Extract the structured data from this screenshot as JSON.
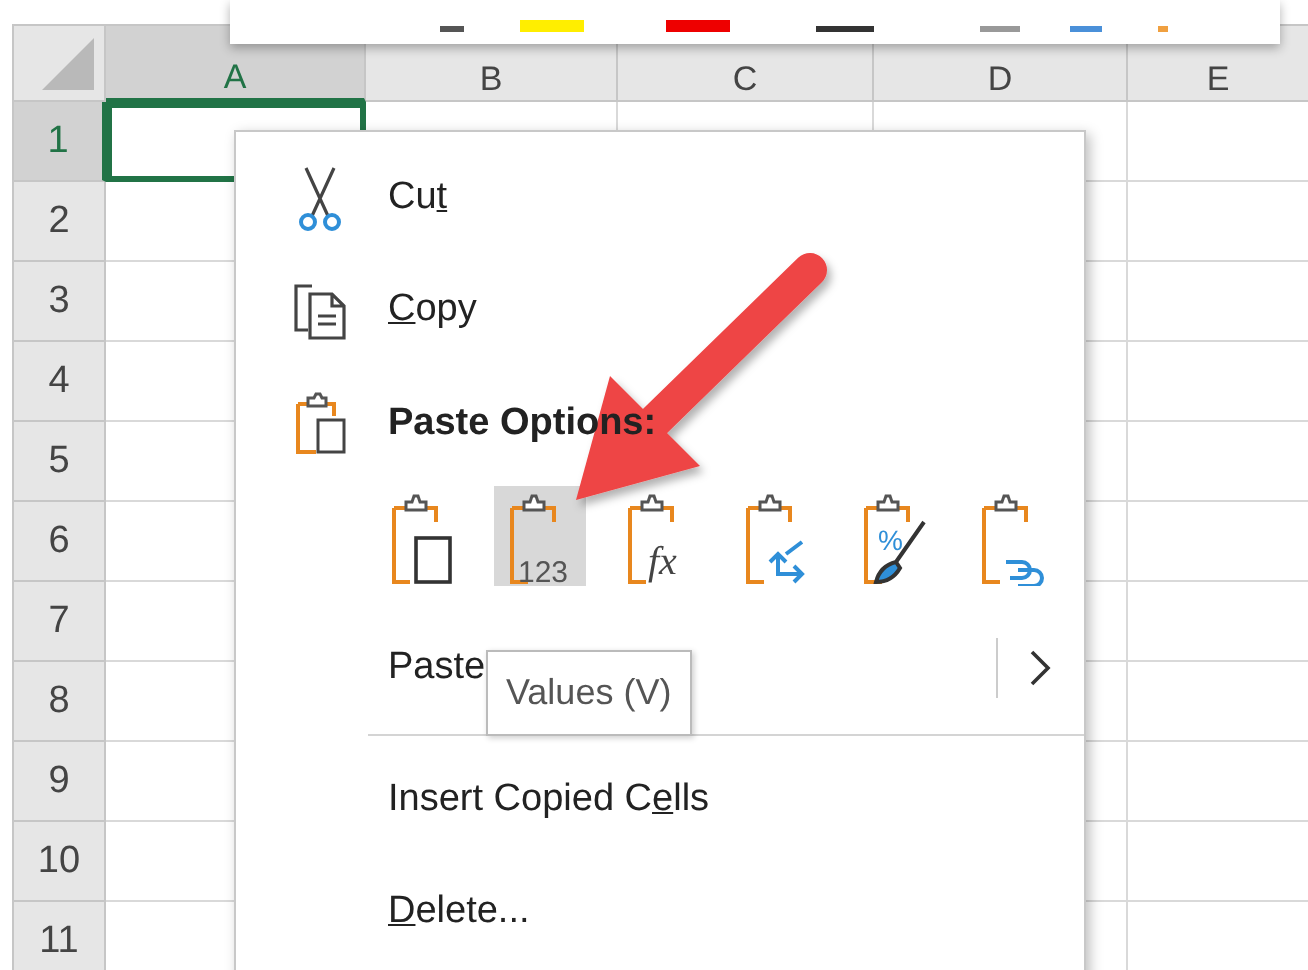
{
  "sheet": {
    "columns": [
      {
        "label": "A",
        "selected": true
      },
      {
        "label": "B",
        "selected": false
      },
      {
        "label": "C",
        "selected": false
      },
      {
        "label": "D",
        "selected": false
      },
      {
        "label": "E",
        "selected": false
      }
    ],
    "rows": [
      {
        "label": "1",
        "selected": true
      },
      {
        "label": "2",
        "selected": false
      },
      {
        "label": "3",
        "selected": false
      },
      {
        "label": "4",
        "selected": false
      },
      {
        "label": "5",
        "selected": false
      },
      {
        "label": "6",
        "selected": false
      },
      {
        "label": "7",
        "selected": false
      },
      {
        "label": "8",
        "selected": false
      },
      {
        "label": "9",
        "selected": false
      },
      {
        "label": "10",
        "selected": false
      },
      {
        "label": "11",
        "selected": false
      }
    ]
  },
  "context_menu": {
    "items": [
      {
        "kind": "cut",
        "text": "Cu",
        "key": "t"
      },
      {
        "kind": "copy",
        "key": "C",
        "rest": "opy"
      },
      {
        "kind": "paste_header",
        "text": "Paste Options:"
      },
      {
        "kind": "paste_options",
        "options": [
          {
            "kind": "paste",
            "selected": false
          },
          {
            "kind": "values",
            "glyph": "123",
            "selected": true
          },
          {
            "kind": "formulas",
            "glyph": "fx",
            "selected": false
          },
          {
            "kind": "transpose",
            "selected": false
          },
          {
            "kind": "formatting",
            "glyph": "%",
            "selected": false
          },
          {
            "kind": "link",
            "selected": false
          }
        ]
      },
      {
        "kind": "submenu",
        "text": "Paste"
      },
      {
        "kind": "separator"
      },
      {
        "kind": "plain",
        "text": "Insert Copied C",
        "key": "e",
        "rest": "lls"
      },
      {
        "kind": "plain",
        "key": "D",
        "rest": "elete..."
      }
    ]
  },
  "tooltip": {
    "text": "Values (V)"
  }
}
